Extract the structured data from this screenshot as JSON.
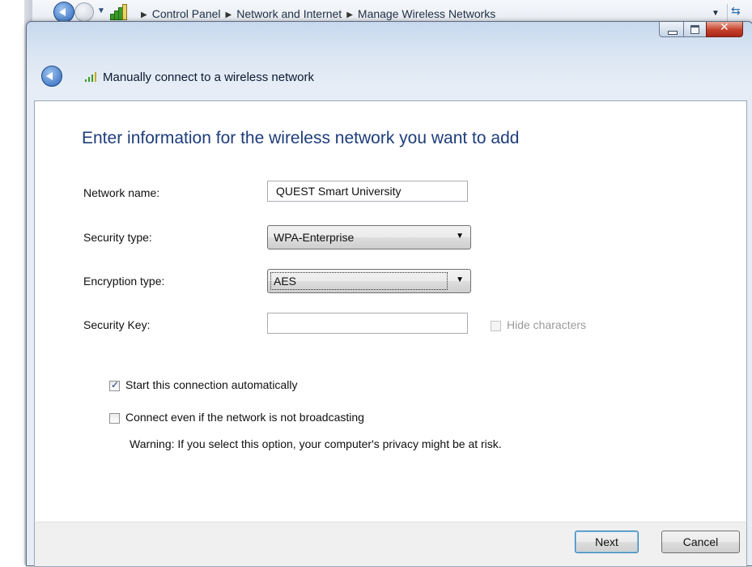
{
  "explorer": {
    "breadcrumbs": [
      "Control Panel",
      "Network and Internet",
      "Manage Wireless Networks"
    ]
  },
  "dialog": {
    "title": "Manually connect to a wireless network",
    "heading": "Enter information for the wireless network you want to add",
    "fields": {
      "network_name": {
        "label": "Network name:",
        "value": "QUEST Smart University"
      },
      "security_type": {
        "label": "Security type:",
        "value": "WPA-Enterprise"
      },
      "encryption_type": {
        "label": "Encryption type:",
        "value": "AES"
      },
      "security_key": {
        "label": "Security Key:",
        "value": "",
        "hide_characters_label": "Hide characters",
        "hide_characters_checked": false
      }
    },
    "options": {
      "start_automatically": {
        "label": "Start this connection automatically",
        "checked": true
      },
      "connect_not_broadcasting": {
        "label": "Connect even if the network is not broadcasting",
        "checked": false
      },
      "warning": "Warning: If you select this option, your computer's privacy might be at risk."
    },
    "buttons": {
      "next": "Next",
      "cancel": "Cancel"
    }
  }
}
